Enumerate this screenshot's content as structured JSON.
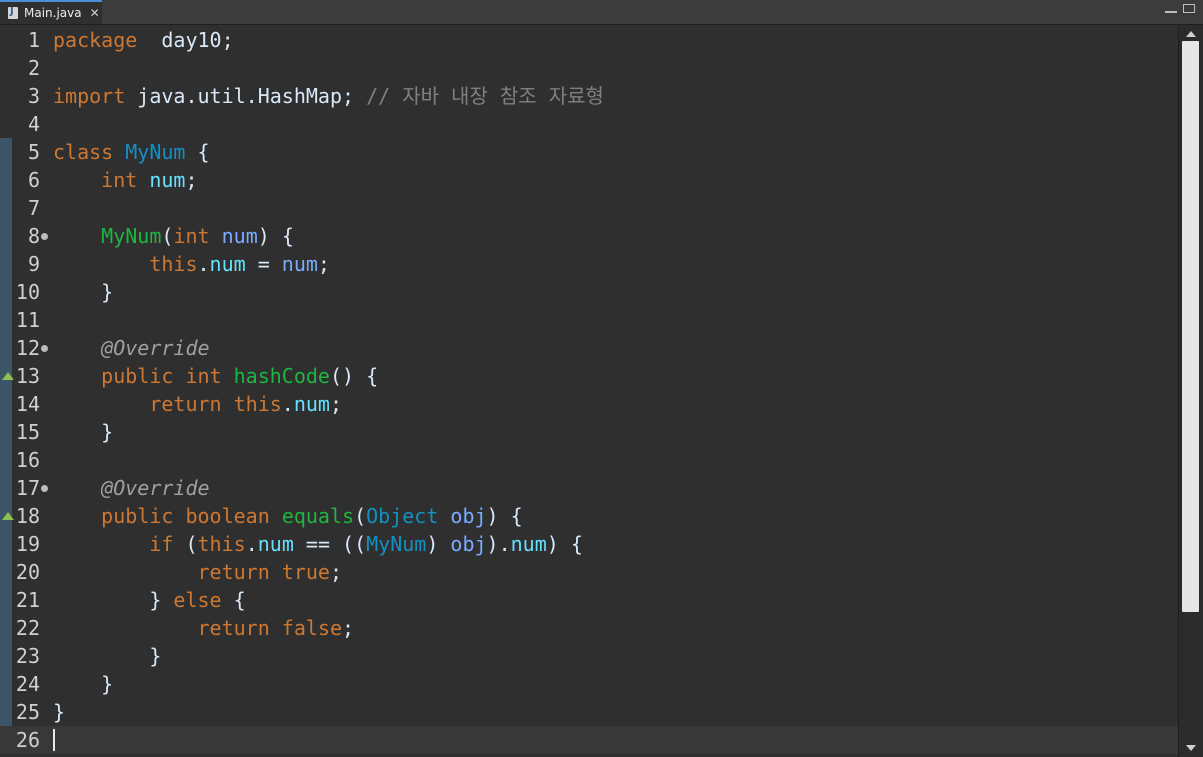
{
  "tab": {
    "label": "Main.java",
    "close": "✕"
  },
  "lines": [
    {
      "num": "1",
      "tokens": [
        [
          "k",
          "package"
        ],
        [
          "",
          "  day10;"
        ]
      ]
    },
    {
      "num": "2",
      "tokens": []
    },
    {
      "num": "3",
      "tokens": [
        [
          "k",
          "import"
        ],
        [
          "",
          " java.util.HashMap; "
        ],
        [
          "c",
          "// 자바 내장 참조 자료형"
        ]
      ]
    },
    {
      "num": "4",
      "tokens": []
    },
    {
      "num": "5",
      "tokens": [
        [
          "k",
          "class"
        ],
        [
          "",
          " "
        ],
        [
          "t",
          "MyNum"
        ],
        [
          "",
          " {"
        ]
      ]
    },
    {
      "num": "6",
      "tokens": [
        [
          "",
          "    "
        ],
        [
          "k",
          "int"
        ],
        [
          "",
          " "
        ],
        [
          "f",
          "num"
        ],
        [
          "",
          ";"
        ]
      ]
    },
    {
      "num": "7",
      "tokens": []
    },
    {
      "num": "8",
      "tokens": [
        [
          "",
          "    "
        ],
        [
          "m",
          "MyNum"
        ],
        [
          "",
          "("
        ],
        [
          "k",
          "int"
        ],
        [
          "",
          " "
        ],
        [
          "p",
          "num"
        ],
        [
          "",
          ") {"
        ]
      ]
    },
    {
      "num": "9",
      "tokens": [
        [
          "",
          "        "
        ],
        [
          "k",
          "this"
        ],
        [
          "",
          "."
        ],
        [
          "f",
          "num"
        ],
        [
          "",
          " = "
        ],
        [
          "p",
          "num"
        ],
        [
          "",
          ";"
        ]
      ]
    },
    {
      "num": "10",
      "tokens": [
        [
          "",
          "    }"
        ]
      ]
    },
    {
      "num": "11",
      "tokens": []
    },
    {
      "num": "12",
      "tokens": [
        [
          "",
          "    "
        ],
        [
          "a",
          "@Override"
        ]
      ]
    },
    {
      "num": "13",
      "tokens": [
        [
          "",
          "    "
        ],
        [
          "k",
          "public"
        ],
        [
          "",
          " "
        ],
        [
          "k",
          "int"
        ],
        [
          "",
          " "
        ],
        [
          "m",
          "hashCode"
        ],
        [
          "",
          "() {"
        ]
      ]
    },
    {
      "num": "14",
      "tokens": [
        [
          "",
          "        "
        ],
        [
          "k",
          "return"
        ],
        [
          "",
          " "
        ],
        [
          "k",
          "this"
        ],
        [
          "",
          "."
        ],
        [
          "f",
          "num"
        ],
        [
          "",
          ";"
        ]
      ]
    },
    {
      "num": "15",
      "tokens": [
        [
          "",
          "    }"
        ]
      ]
    },
    {
      "num": "16",
      "tokens": []
    },
    {
      "num": "17",
      "tokens": [
        [
          "",
          "    "
        ],
        [
          "a",
          "@Override"
        ]
      ]
    },
    {
      "num": "18",
      "tokens": [
        [
          "",
          "    "
        ],
        [
          "k",
          "public"
        ],
        [
          "",
          " "
        ],
        [
          "k",
          "boolean"
        ],
        [
          "",
          " "
        ],
        [
          "m",
          "equals"
        ],
        [
          "",
          "("
        ],
        [
          "t",
          "Object"
        ],
        [
          "",
          " "
        ],
        [
          "p",
          "obj"
        ],
        [
          "",
          ") {"
        ]
      ]
    },
    {
      "num": "19",
      "tokens": [
        [
          "",
          "        "
        ],
        [
          "k",
          "if"
        ],
        [
          "",
          " ("
        ],
        [
          "k",
          "this"
        ],
        [
          "",
          "."
        ],
        [
          "f",
          "num"
        ],
        [
          "",
          " == (("
        ],
        [
          "t",
          "MyNum"
        ],
        [
          "",
          ") "
        ],
        [
          "p",
          "obj"
        ],
        [
          "",
          ")."
        ],
        [
          "f",
          "num"
        ],
        [
          "",
          ") {"
        ]
      ]
    },
    {
      "num": "20",
      "tokens": [
        [
          "",
          "            "
        ],
        [
          "k",
          "return"
        ],
        [
          "",
          " "
        ],
        [
          "k",
          "true"
        ],
        [
          "",
          ";"
        ]
      ]
    },
    {
      "num": "21",
      "tokens": [
        [
          "",
          "        } "
        ],
        [
          "k",
          "else"
        ],
        [
          "",
          " {"
        ]
      ]
    },
    {
      "num": "22",
      "tokens": [
        [
          "",
          "            "
        ],
        [
          "k",
          "return"
        ],
        [
          "",
          " "
        ],
        [
          "k",
          "false"
        ],
        [
          "",
          ";"
        ]
      ]
    },
    {
      "num": "23",
      "tokens": [
        [
          "",
          "        }"
        ]
      ]
    },
    {
      "num": "24",
      "tokens": [
        [
          "",
          "    }"
        ]
      ]
    },
    {
      "num": "25",
      "tokens": [
        [
          "",
          "}"
        ]
      ]
    },
    {
      "num": "26",
      "tokens": []
    }
  ],
  "folds": [
    "8",
    "12",
    "17"
  ],
  "override_markers": [
    "13",
    "18"
  ],
  "marked_range": [
    "5",
    "25"
  ],
  "current_line": "26"
}
